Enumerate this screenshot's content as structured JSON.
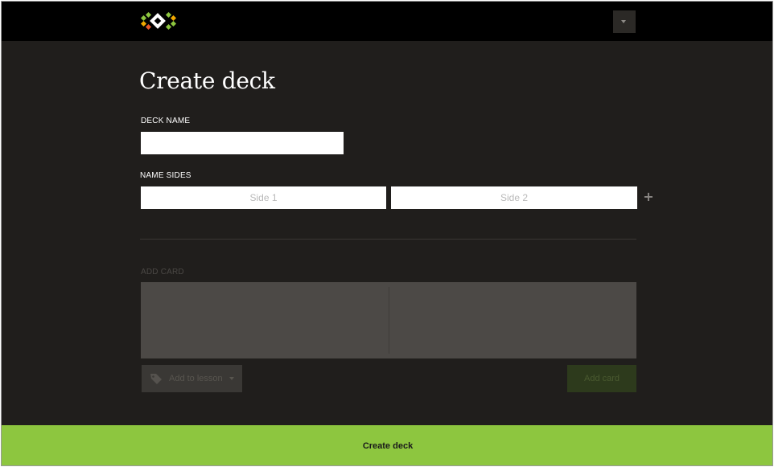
{
  "header": {
    "logo_icon": "app-logo-diamond-icon",
    "menu_icon": "caret-down-icon"
  },
  "main": {
    "title": "Create deck",
    "deck_name": {
      "label": "DECK NAME",
      "value": "",
      "placeholder": ""
    },
    "name_sides": {
      "label": "NAME SIDES",
      "side1_placeholder": "Side 1",
      "side2_placeholder": "Side 2",
      "add_icon": "plus-icon"
    },
    "add_card": {
      "label": "ADD CARD",
      "side1_value": "",
      "side2_value": "",
      "lesson_button_label": "Add to lesson",
      "lesson_icon": "tag-icon",
      "add_button_label": "Add card"
    }
  },
  "footer": {
    "create_button_label": "Create deck"
  },
  "colors": {
    "background": "#201e1c",
    "topbar": "#000000",
    "accent_green": "#8dc63f",
    "input_bg": "#ffffff",
    "card_area": "#4c4946"
  }
}
